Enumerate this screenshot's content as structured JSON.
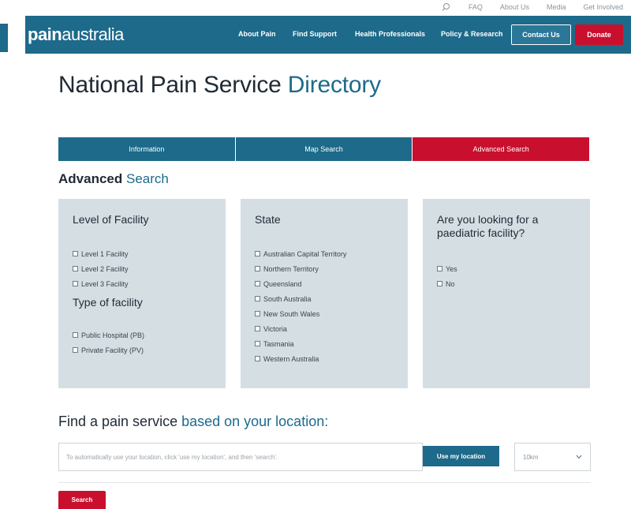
{
  "utility": {
    "items": [
      "FAQ",
      "About Us",
      "Media",
      "Get Involved"
    ]
  },
  "logo": {
    "bold": "pain",
    "light": "australia"
  },
  "nav": {
    "links": [
      "About Pain",
      "Find Support",
      "Health Professionals",
      "Policy & Research"
    ],
    "contact_label": "Contact Us",
    "donate_label": "Donate"
  },
  "page": {
    "title_main": "National Pain Service",
    "title_accent": "Directory"
  },
  "tabs": [
    "Information",
    "Map Search",
    "Advanced Search"
  ],
  "advanced": {
    "title_main": "Advanced",
    "title_accent": "Search"
  },
  "facility": {
    "level_title": "Level of Facility",
    "levels": [
      "Level 1 Facility",
      "Level 2 Facility",
      "Level 3 Facility"
    ],
    "type_title": "Type of facility",
    "types": [
      "Public Hospital (PB)",
      "Private Facility (PV)"
    ]
  },
  "state": {
    "title": "State",
    "items": [
      "Australian Capital Territory",
      "Northern Territory",
      "Queensland",
      "South Australia",
      "New South Wales",
      "Victoria",
      "Tasmania",
      "Western Australia"
    ]
  },
  "paediatric": {
    "title": "Are you looking for a paediatric facility?",
    "options": [
      "Yes",
      "No"
    ]
  },
  "location": {
    "title_main": "Find a pain service",
    "title_accent": "based on your location:",
    "placeholder": "To automatically use your location, click 'use my location', and then 'search'.",
    "use_label": "Use my location",
    "radius": "10km",
    "search_label": "Search"
  },
  "colors": {
    "primary": "#1d6a8a",
    "accent_red": "#c8102e",
    "panel_bg": "#d5dee3"
  }
}
